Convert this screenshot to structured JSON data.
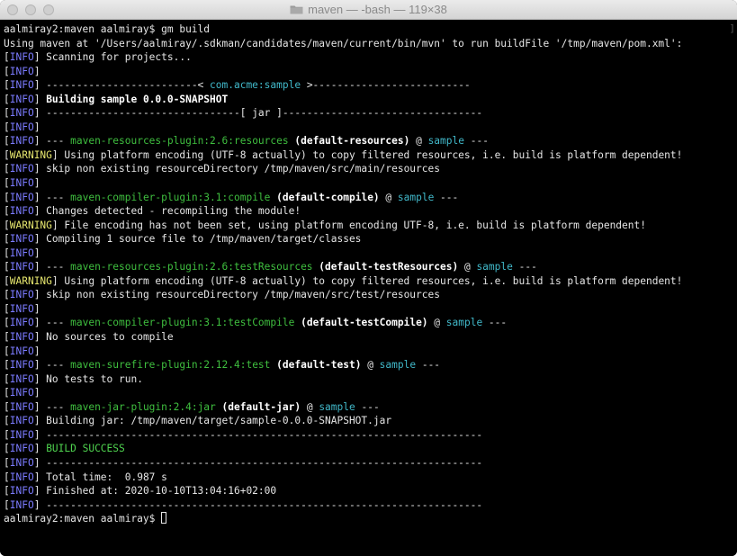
{
  "window": {
    "title": "maven — -bash — 119×38",
    "folder_icon": "folder-icon"
  },
  "colors": {
    "background": "#000000",
    "text": "#e6e6e6",
    "info": "#7b7bff",
    "warning": "#e6e66e",
    "cyan": "#41b8c9",
    "green": "#3fbf3f",
    "success": "#4fd44f"
  },
  "terminal": {
    "prompt_final": "aalmiray2:maven aalmiray$ ",
    "lines": [
      [
        {
          "t": "aalmiray2:maven aalmiray$ gm build",
          "s": "default"
        }
      ],
      [
        {
          "t": "Using maven at '/Users/aalmiray/.sdkman/candidates/maven/current/bin/mvn' to run buildFile '/tmp/maven/pom.xml':",
          "s": "default"
        }
      ],
      [
        {
          "t": "[",
          "s": "default"
        },
        {
          "t": "INFO",
          "s": "info"
        },
        {
          "t": "] Scanning for projects...",
          "s": "default"
        }
      ],
      [
        {
          "t": "[",
          "s": "default"
        },
        {
          "t": "INFO",
          "s": "info"
        },
        {
          "t": "]",
          "s": "default"
        }
      ],
      [
        {
          "t": "[",
          "s": "default"
        },
        {
          "t": "INFO",
          "s": "info"
        },
        {
          "t": "] -------------------------< ",
          "s": "default"
        },
        {
          "t": "com.acme:sample",
          "s": "cyan"
        },
        {
          "t": " >--------------------------",
          "s": "default"
        }
      ],
      [
        {
          "t": "[",
          "s": "default"
        },
        {
          "t": "INFO",
          "s": "info"
        },
        {
          "t": "] ",
          "s": "default"
        },
        {
          "t": "Building sample 0.0.0-SNAPSHOT",
          "s": "bold"
        }
      ],
      [
        {
          "t": "[",
          "s": "default"
        },
        {
          "t": "INFO",
          "s": "info"
        },
        {
          "t": "] --------------------------------[ jar ]---------------------------------",
          "s": "default"
        }
      ],
      [
        {
          "t": "[",
          "s": "default"
        },
        {
          "t": "INFO",
          "s": "info"
        },
        {
          "t": "]",
          "s": "default"
        }
      ],
      [
        {
          "t": "[",
          "s": "default"
        },
        {
          "t": "INFO",
          "s": "info"
        },
        {
          "t": "] --- ",
          "s": "default"
        },
        {
          "t": "maven-resources-plugin:2.6:resources",
          "s": "green"
        },
        {
          "t": " ",
          "s": "default"
        },
        {
          "t": "(default-resources)",
          "s": "bold"
        },
        {
          "t": " @ ",
          "s": "default"
        },
        {
          "t": "sample",
          "s": "cyan"
        },
        {
          "t": " ---",
          "s": "default"
        }
      ],
      [
        {
          "t": "[",
          "s": "default"
        },
        {
          "t": "WARNING",
          "s": "warn"
        },
        {
          "t": "] Using platform encoding (UTF-8 actually) to copy filtered resources, i.e. build is platform dependent!",
          "s": "default"
        }
      ],
      [
        {
          "t": "[",
          "s": "default"
        },
        {
          "t": "INFO",
          "s": "info"
        },
        {
          "t": "] skip non existing resourceDirectory /tmp/maven/src/main/resources",
          "s": "default"
        }
      ],
      [
        {
          "t": "[",
          "s": "default"
        },
        {
          "t": "INFO",
          "s": "info"
        },
        {
          "t": "]",
          "s": "default"
        }
      ],
      [
        {
          "t": "[",
          "s": "default"
        },
        {
          "t": "INFO",
          "s": "info"
        },
        {
          "t": "] --- ",
          "s": "default"
        },
        {
          "t": "maven-compiler-plugin:3.1:compile",
          "s": "green"
        },
        {
          "t": " ",
          "s": "default"
        },
        {
          "t": "(default-compile)",
          "s": "bold"
        },
        {
          "t": " @ ",
          "s": "default"
        },
        {
          "t": "sample",
          "s": "cyan"
        },
        {
          "t": " ---",
          "s": "default"
        }
      ],
      [
        {
          "t": "[",
          "s": "default"
        },
        {
          "t": "INFO",
          "s": "info"
        },
        {
          "t": "] Changes detected - recompiling the module!",
          "s": "default"
        }
      ],
      [
        {
          "t": "[",
          "s": "default"
        },
        {
          "t": "WARNING",
          "s": "warn"
        },
        {
          "t": "] File encoding has not been set, using platform encoding UTF-8, i.e. build is platform dependent!",
          "s": "default"
        }
      ],
      [
        {
          "t": "[",
          "s": "default"
        },
        {
          "t": "INFO",
          "s": "info"
        },
        {
          "t": "] Compiling 1 source file to /tmp/maven/target/classes",
          "s": "default"
        }
      ],
      [
        {
          "t": "[",
          "s": "default"
        },
        {
          "t": "INFO",
          "s": "info"
        },
        {
          "t": "]",
          "s": "default"
        }
      ],
      [
        {
          "t": "[",
          "s": "default"
        },
        {
          "t": "INFO",
          "s": "info"
        },
        {
          "t": "] --- ",
          "s": "default"
        },
        {
          "t": "maven-resources-plugin:2.6:testResources",
          "s": "green"
        },
        {
          "t": " ",
          "s": "default"
        },
        {
          "t": "(default-testResources)",
          "s": "bold"
        },
        {
          "t": " @ ",
          "s": "default"
        },
        {
          "t": "sample",
          "s": "cyan"
        },
        {
          "t": " ---",
          "s": "default"
        }
      ],
      [
        {
          "t": "[",
          "s": "default"
        },
        {
          "t": "WARNING",
          "s": "warn"
        },
        {
          "t": "] Using platform encoding (UTF-8 actually) to copy filtered resources, i.e. build is platform dependent!",
          "s": "default"
        }
      ],
      [
        {
          "t": "[",
          "s": "default"
        },
        {
          "t": "INFO",
          "s": "info"
        },
        {
          "t": "] skip non existing resourceDirectory /tmp/maven/src/test/resources",
          "s": "default"
        }
      ],
      [
        {
          "t": "[",
          "s": "default"
        },
        {
          "t": "INFO",
          "s": "info"
        },
        {
          "t": "]",
          "s": "default"
        }
      ],
      [
        {
          "t": "[",
          "s": "default"
        },
        {
          "t": "INFO",
          "s": "info"
        },
        {
          "t": "] --- ",
          "s": "default"
        },
        {
          "t": "maven-compiler-plugin:3.1:testCompile",
          "s": "green"
        },
        {
          "t": " ",
          "s": "default"
        },
        {
          "t": "(default-testCompile)",
          "s": "bold"
        },
        {
          "t": " @ ",
          "s": "default"
        },
        {
          "t": "sample",
          "s": "cyan"
        },
        {
          "t": " ---",
          "s": "default"
        }
      ],
      [
        {
          "t": "[",
          "s": "default"
        },
        {
          "t": "INFO",
          "s": "info"
        },
        {
          "t": "] No sources to compile",
          "s": "default"
        }
      ],
      [
        {
          "t": "[",
          "s": "default"
        },
        {
          "t": "INFO",
          "s": "info"
        },
        {
          "t": "]",
          "s": "default"
        }
      ],
      [
        {
          "t": "[",
          "s": "default"
        },
        {
          "t": "INFO",
          "s": "info"
        },
        {
          "t": "] --- ",
          "s": "default"
        },
        {
          "t": "maven-surefire-plugin:2.12.4:test",
          "s": "green"
        },
        {
          "t": " ",
          "s": "default"
        },
        {
          "t": "(default-test)",
          "s": "bold"
        },
        {
          "t": " @ ",
          "s": "default"
        },
        {
          "t": "sample",
          "s": "cyan"
        },
        {
          "t": " ---",
          "s": "default"
        }
      ],
      [
        {
          "t": "[",
          "s": "default"
        },
        {
          "t": "INFO",
          "s": "info"
        },
        {
          "t": "] No tests to run.",
          "s": "default"
        }
      ],
      [
        {
          "t": "[",
          "s": "default"
        },
        {
          "t": "INFO",
          "s": "info"
        },
        {
          "t": "]",
          "s": "default"
        }
      ],
      [
        {
          "t": "[",
          "s": "default"
        },
        {
          "t": "INFO",
          "s": "info"
        },
        {
          "t": "] --- ",
          "s": "default"
        },
        {
          "t": "maven-jar-plugin:2.4:jar",
          "s": "green"
        },
        {
          "t": " ",
          "s": "default"
        },
        {
          "t": "(default-jar)",
          "s": "bold"
        },
        {
          "t": " @ ",
          "s": "default"
        },
        {
          "t": "sample",
          "s": "cyan"
        },
        {
          "t": " ---",
          "s": "default"
        }
      ],
      [
        {
          "t": "[",
          "s": "default"
        },
        {
          "t": "INFO",
          "s": "info"
        },
        {
          "t": "] Building jar: /tmp/maven/target/sample-0.0.0-SNAPSHOT.jar",
          "s": "default"
        }
      ],
      [
        {
          "t": "[",
          "s": "default"
        },
        {
          "t": "INFO",
          "s": "info"
        },
        {
          "t": "] ------------------------------------------------------------------------",
          "s": "default"
        }
      ],
      [
        {
          "t": "[",
          "s": "default"
        },
        {
          "t": "INFO",
          "s": "info"
        },
        {
          "t": "] ",
          "s": "default"
        },
        {
          "t": "BUILD SUCCESS",
          "s": "success"
        }
      ],
      [
        {
          "t": "[",
          "s": "default"
        },
        {
          "t": "INFO",
          "s": "info"
        },
        {
          "t": "] ------------------------------------------------------------------------",
          "s": "default"
        }
      ],
      [
        {
          "t": "[",
          "s": "default"
        },
        {
          "t": "INFO",
          "s": "info"
        },
        {
          "t": "] Total time:  0.987 s",
          "s": "default"
        }
      ],
      [
        {
          "t": "[",
          "s": "default"
        },
        {
          "t": "INFO",
          "s": "info"
        },
        {
          "t": "] Finished at: 2020-10-10T13:04:16+02:00",
          "s": "default"
        }
      ],
      [
        {
          "t": "[",
          "s": "default"
        },
        {
          "t": "INFO",
          "s": "info"
        },
        {
          "t": "] ------------------------------------------------------------------------",
          "s": "default"
        }
      ]
    ]
  }
}
